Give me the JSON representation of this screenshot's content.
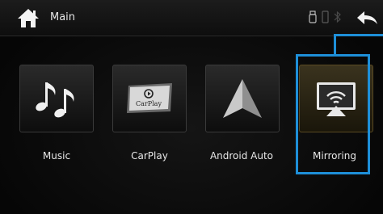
{
  "header": {
    "title": "Main",
    "icons": {
      "home": "home-icon",
      "usb": "usb-icon",
      "phone": "phone-icon",
      "bluetooth": "bluetooth-icon",
      "back": "back-arrow-icon"
    }
  },
  "apps": [
    {
      "label": "Music",
      "icon": "music-notes-icon"
    },
    {
      "label": "CarPlay",
      "icon": "carplay-icon",
      "icon_text": "CarPlay"
    },
    {
      "label": "Android Auto",
      "icon": "android-auto-icon"
    },
    {
      "label": "Mirroring",
      "icon": "mirroring-icon",
      "selected": true
    }
  ],
  "colors": {
    "highlight": "#1e8fd8",
    "text": "#e8e8e8",
    "selected_tile": "#3a331e"
  }
}
